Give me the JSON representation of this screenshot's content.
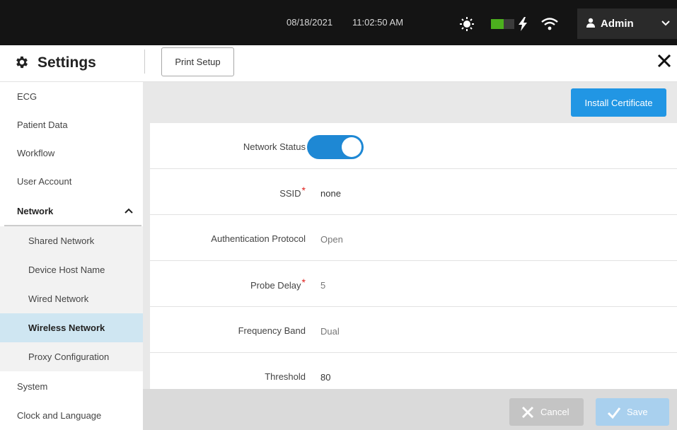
{
  "status_bar": {
    "date": "08/18/2021",
    "time": "11:02:50 AM",
    "battery_level": 0.55,
    "icons": [
      "brightness-icon",
      "battery-icon",
      "charging-bolt-icon",
      "wifi-icon"
    ],
    "user": {
      "name": "Admin",
      "icon": "user-icon",
      "menu_icon": "chevron-down-icon"
    }
  },
  "header": {
    "title": "Settings",
    "title_icon": "gear-icon",
    "tabs": [
      {
        "label": "Print Setup"
      }
    ],
    "close_icon": "close-icon"
  },
  "sidebar": {
    "items": [
      {
        "label": "ECG"
      },
      {
        "label": "Patient Data"
      },
      {
        "label": "Workflow"
      },
      {
        "label": "User Account"
      },
      {
        "label": "Network",
        "expanded": true
      },
      {
        "label": "Shared Network"
      },
      {
        "label": "Device Host Name"
      },
      {
        "label": "Wired Network"
      },
      {
        "label": "Wireless Network",
        "selected": true
      },
      {
        "label": "Proxy Configuration"
      },
      {
        "label": "System"
      },
      {
        "label": "Clock and Language"
      }
    ]
  },
  "main": {
    "install_certificate_label": "Install Certificate",
    "fields": [
      {
        "label": "Network Status",
        "type": "toggle",
        "on": true
      },
      {
        "label": "SSID",
        "required": true,
        "value": "none"
      },
      {
        "label": "Authentication Protocol",
        "value": "Open"
      },
      {
        "label": "Probe Delay",
        "required": true,
        "value": "5"
      },
      {
        "label": "Frequency Band",
        "value": "Dual"
      },
      {
        "label": "Threshold",
        "value": "80"
      }
    ],
    "required_marker": "*",
    "footer": {
      "cancel_label": "Cancel",
      "save_label": "Save"
    }
  },
  "colors": {
    "top_bar": "#141414",
    "accent_blue": "#2196e4",
    "toggle_on": "#1e88d4",
    "selected_item_bg": "#cfe6f2",
    "required": "#e0201d",
    "battery": "#4cb01e"
  }
}
